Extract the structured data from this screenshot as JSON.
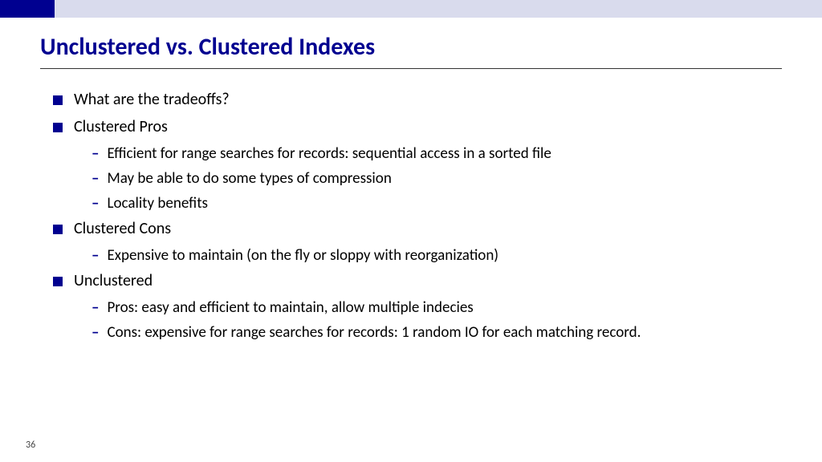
{
  "slide": {
    "title": "Unclustered vs. Clustered Indexes",
    "bullets": [
      {
        "text": "What are the tradeoffs?",
        "subs": []
      },
      {
        "text": "Clustered Pros",
        "subs": [
          "Efficient for range searches for records: sequential access in a sorted file",
          "May be able to do some types of compression",
          "Locality benefits"
        ]
      },
      {
        "text": "Clustered Cons",
        "subs": [
          "Expensive to maintain (on the fly or sloppy with reorganization)"
        ]
      },
      {
        "text": "Unclustered",
        "subs": [
          "Pros: easy and efficient to maintain, allow multiple indecies",
          "Cons: expensive for range searches for records: 1 random IO for each matching record."
        ]
      }
    ],
    "page_number": "36"
  }
}
